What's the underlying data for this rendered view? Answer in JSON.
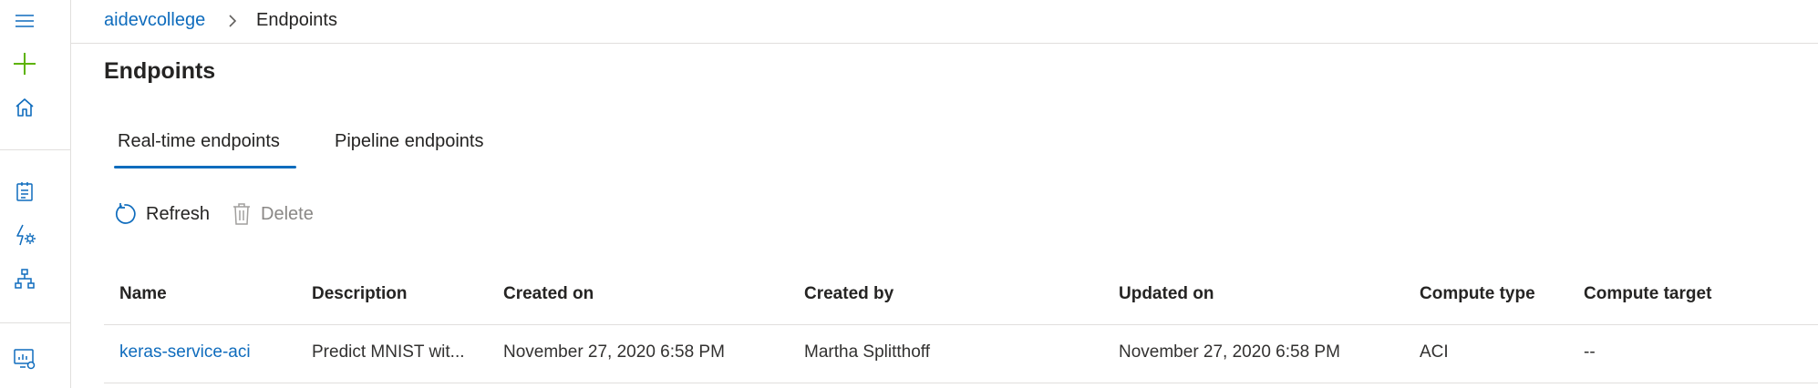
{
  "breadcrumb": {
    "workspace": "aidevcollege",
    "current": "Endpoints"
  },
  "page": {
    "title": "Endpoints"
  },
  "tabs": [
    {
      "label": "Real-time endpoints",
      "active": true
    },
    {
      "label": "Pipeline endpoints",
      "active": false
    }
  ],
  "toolbar": {
    "refresh": "Refresh",
    "delete": "Delete"
  },
  "table": {
    "columns": [
      "Name",
      "Description",
      "Created on",
      "Created by",
      "Updated on",
      "Compute type",
      "Compute target"
    ],
    "rows": [
      [
        "keras-service-aci",
        "Predict MNIST wit...",
        "November 27, 2020 6:58 PM",
        "Martha Splitthoff",
        "November 27, 2020 6:58 PM",
        "ACI",
        "--"
      ]
    ]
  },
  "sidebar": {
    "icons": [
      "hamburger-icon",
      "add-icon",
      "home-icon",
      "notebook-icon",
      "automated-ml-icon",
      "designer-icon",
      "compute-icon"
    ]
  },
  "colors": {
    "accent": "#0f6cbd",
    "add_green": "#5db300",
    "disabled": "#a19f9d",
    "border": "#e1dfdd"
  }
}
